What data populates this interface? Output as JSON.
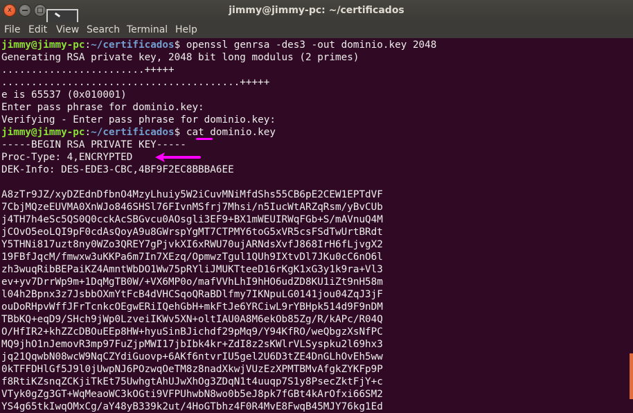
{
  "window": {
    "title": "jimmy@jimmy-pc: ~/certificados",
    "close_glyph": "x"
  },
  "menu": [
    "File",
    "Edit",
    "View",
    "Search",
    "Terminal",
    "Help"
  ],
  "prompt": {
    "user_host": "jimmy@jimmy-pc",
    "colon": ":",
    "path": "~/certificados",
    "dollar": "$"
  },
  "terminal": {
    "cmd1": " openssl genrsa -des3 -out dominio.key 2048",
    "out": [
      "Generating RSA private key, 2048 bit long modulus (2 primes)",
      "........................+++++",
      "........................................+++++",
      "e is 65537 (0x010001)",
      "Enter pass phrase for dominio.key:",
      "Verifying - Enter pass phrase for dominio.key:"
    ],
    "cmd2_pre": " ",
    "cmd2_cat": "cat",
    "cmd2_post": " dominio.key",
    "key_header": [
      "-----BEGIN RSA PRIVATE KEY-----",
      "Proc-Type: 4,ENCRYPTED",
      "DEK-Info: DES-EDE3-CBC,4BF9F2EC8BBBA6EE",
      ""
    ],
    "key_body": [
      "A8zTr9JZ/xyDZEdnDfbnO4MzyLhuiy5W2iCuvMNiMfdShs55CB6pE2CEW1EPTdVF",
      "7CbjMQzeEUVMA0XnWJo846SHSl76FIvnMSfrj7Mhsi/n5IucWtARZqRsm/yBvCUb",
      "j4TH7h4eSc5QS0Q0cckAcSBGvcu0AOsgli3EF9+BX1mWEUIRWqFGb+S/mAVnuQ4M",
      "jCOvO5eoLQI9pF0cdAsQoyA9u8GWrspYgMT7CTPMY6toG5xVR5csFSdTwUrtBRdt",
      "Y5THNi817uzt8ny0WZo3QREY7gPjvkXI6xRWU70ujARNdsXvfJ868IrH6fLjvgX2",
      "19FBfJqcM/fmwxw3uKKPa6m7In7XEzq/OpmwzTgul1QUh9IXtvDl7JKu0cC6nO6l",
      "zh3wuqRibBEPaiKZ4AmntWbDO1Ww75pRYliJMUKTteeD16rKgK1xG3y1k9ra+Vl3",
      "ev+yv7DrrWp9m+1DqMgTB0W/+VX6MP0o/mafVVhLhI9hHO6udZD8KU1iZt9nH58m",
      "l04h2Bpnx3z7JsbbOXmYtFcB4dVHCSqoQRaBDlfmy7IKNpuLG0141jou04ZqJ3jF",
      "ouDoRHpvWffJFrTcnkcOEgwERiIQehGbH+mkFtJe6YRCiwL9rYBHpk514d9F9nDM",
      "TBbKQ+eqD9/SHch9jWp0LzveiIKWv5XN+oltIAU0A8M6ekOb85Zg/R/kAPc/R04Q",
      "O/HfIR2+khZZcDBOuEEp8HW+hyuSinBJichdf29pMq9/Y94KfRO/weQbgzXsNfPC",
      "MQ9jhO1nJemovR3mp97FuZjpMWI17jbIbk4kr+ZdI8z2sKWlrVLSyspku2l69hx3",
      "jq21QqwbN08wcW9NqCZYdiGuovp+6AKf6ntvrIU5gel2U6D3tZE4DnGLhOvEh5ww",
      "0kTFFDHlGf5J9l0jUwpNJ6POzwqOeTM8z8nadXkwjVUzEzXPMTBMvAfgkZYKFp9P",
      "f8RtiKZsnqZCKjiTkEt75UwhgtAhUJwXhOg3ZDqN1t4uuqp7S1y8PsecZktFjY+c",
      "VTyk0gZg3GT+WqMeaoWC3kOGti9VFPUhwbN8wo0b5eJ8pk7fGBt4kArOfxi66SM2",
      "YS4g65tkIwqOMxCg/aY48yB339k2ut/4HoGTbhz4F0R4MvE8FwqB45MJY76kg1Ed"
    ]
  },
  "annotations": {
    "highlight_color": "#ff00ff",
    "underline_target": "cat",
    "arrow_target": "Proc-Type: 4,ENCRYPTED"
  },
  "colors": {
    "background": "#300a24",
    "prompt_user": "#8ae234",
    "prompt_path": "#729fcf",
    "scroll_thumb": "#e16e3c"
  }
}
